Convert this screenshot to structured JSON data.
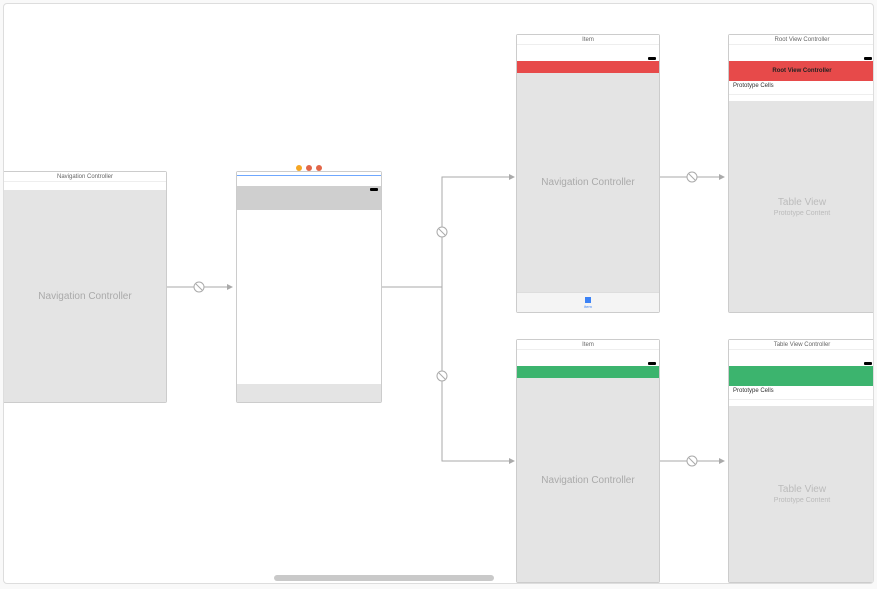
{
  "scenes": {
    "navA": {
      "title": "Navigation Controller",
      "bodyLabel": "Navigation Controller"
    },
    "tabVC": {
      "tabItemLabel": "item"
    },
    "navRed": {
      "title": "Item",
      "bodyLabel": "Navigation Controller",
      "navColor": "#e74a4a"
    },
    "navGreen": {
      "title": "Item",
      "bodyLabel": "Navigation Controller",
      "navColor": "#3cb46e"
    },
    "rootRed": {
      "title": "Root View Controller",
      "navTitle": "Root View Controller",
      "navColor": "#e74a4a",
      "proto": "Prototype Cells",
      "tableLabel": "Table View",
      "tableSub": "Prototype Content"
    },
    "tableGreen": {
      "title": "Table View Controller",
      "navColor": "#3cb46e",
      "proto": "Prototype Cells",
      "tableLabel": "Table View",
      "tableSub": "Prototype Content"
    }
  }
}
